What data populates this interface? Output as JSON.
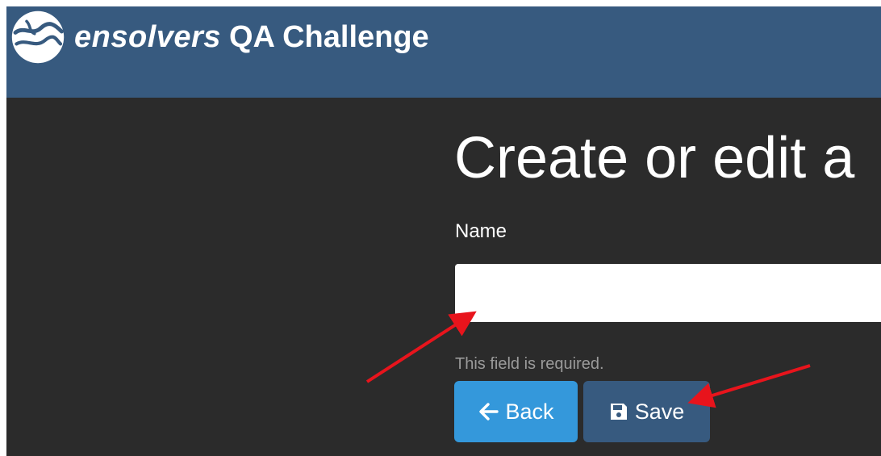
{
  "header": {
    "logo": "ensolvers-globe-logo",
    "brand_word": "ensolvers",
    "title": "QA Challenge",
    "background_color": "#375a7f"
  },
  "page": {
    "title": "Create or edit a"
  },
  "form": {
    "name_label": "Name",
    "name_value": "",
    "name_placeholder": "",
    "validation_message": "This field is required."
  },
  "buttons": {
    "back_label": "Back",
    "back_icon": "arrow-left-icon",
    "back_color": "#3498db",
    "save_label": "Save",
    "save_icon": "floppy-disk-icon",
    "save_color": "#375a7f"
  },
  "colors": {
    "content_background": "#2b2b2b",
    "annotation_arrow": "#e8141c"
  }
}
